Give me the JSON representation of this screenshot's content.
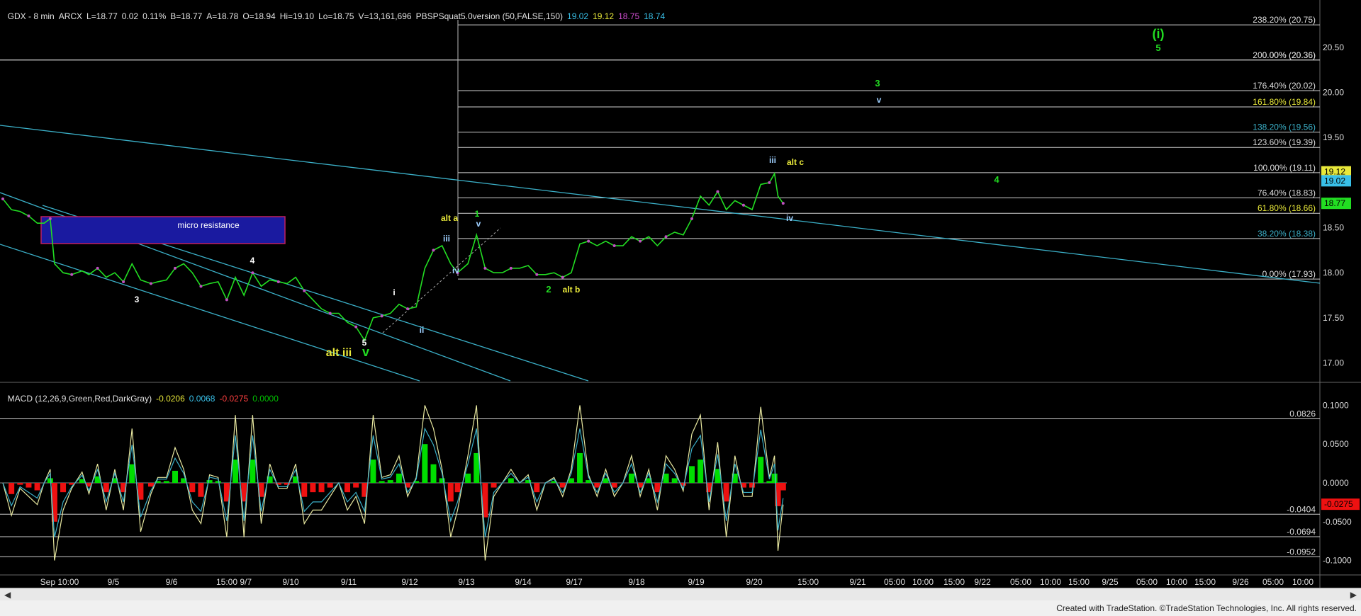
{
  "header": {
    "symbol": "GDX - 8 min",
    "exchange": "ARCX",
    "last": "L=18.77",
    "change": "0.02",
    "change_pct": "0.11%",
    "bid": "B=18.77",
    "ask": "A=18.78",
    "open": "O=18.94",
    "high": "Hi=19.10",
    "low": "Lo=18.75",
    "volume": "V=13,161,696",
    "indicator": "PBSPSquat5.0version (50,FALSE,150)",
    "ind_vals": [
      "19.02",
      "19.12",
      "18.75",
      "18.74"
    ],
    "ind_colors": [
      "#39c0e8",
      "#e8e83a",
      "#d24fd2",
      "#39c0e8"
    ]
  },
  "macd_header": {
    "label": "MACD (12,26,9,Green,Red,DarkGray)",
    "vals": [
      "-0.0206",
      "0.0068",
      "-0.0275",
      "0.0000"
    ],
    "colors": [
      "#e8e83a",
      "#39c0e8",
      "#ff4040",
      "#00c000"
    ]
  },
  "colors": {
    "price": "#22dd22",
    "fib_line": "#d0d0d0",
    "trend_line": "#3bb0c8",
    "micro_box": "#1a1aa0",
    "micro_border": "#c02060",
    "macd_pos": "#00dd00",
    "macd_neg": "#ee1111",
    "macd_line": "#e8e8a0",
    "signal_line": "#3bb0c8"
  },
  "chart_data": {
    "type": "line",
    "title": "GDX - 8 min",
    "ylim": [
      16.8,
      20.9
    ],
    "yticks": [
      "20.50",
      "20.00",
      "19.50",
      "19.00",
      "18.50",
      "18.00",
      "17.50",
      "17.00"
    ],
    "xticks": [
      "Sep 10:00",
      "9/5",
      "9/6",
      "15:00 9/7",
      "9/10",
      "9/11",
      "9/12",
      "9/13",
      "9/14",
      "9/17",
      "9/18",
      "9/19",
      "9/20",
      "15:00",
      "9/21",
      "05:00",
      "10:00",
      "15:00",
      "9/22",
      "05:00",
      "10:00",
      "15:00",
      "9/25",
      "05:00",
      "10:00",
      "15:00",
      "9/26",
      "05:00",
      "10:00"
    ],
    "series": [
      {
        "x": [
          0,
          10,
          20,
          30,
          40,
          48,
          55,
          60,
          70,
          80,
          92,
          100,
          110,
          120,
          130,
          140,
          150,
          160,
          172,
          180,
          190,
          200,
          210,
          220,
          230,
          240,
          250,
          260,
          270,
          280,
          290,
          300,
          310,
          320,
          330,
          340,
          350,
          360,
          370,
          380,
          390,
          400,
          410,
          420,
          430,
          440,
          450,
          460,
          470,
          480,
          490,
          500,
          510,
          520,
          528,
          540,
          550,
          560,
          570,
          580,
          590,
          600,
          610,
          620,
          630,
          640,
          650,
          660,
          670,
          680,
          690,
          700,
          710,
          720,
          730,
          740,
          750,
          760,
          770,
          780,
          790,
          800,
          810,
          820,
          830,
          840,
          850,
          860,
          870,
          880,
          890,
          896,
          900,
          906
        ],
        "values": [
          18.82,
          18.7,
          18.68,
          18.63,
          18.55,
          18.55,
          18.6,
          18.1,
          18.0,
          17.98,
          18.02,
          17.98,
          18.05,
          17.95,
          18.0,
          17.9,
          18.1,
          17.92,
          17.88,
          17.9,
          17.92,
          18.05,
          18.1,
          18.0,
          17.85,
          17.88,
          17.9,
          17.7,
          17.95,
          17.75,
          18.0,
          17.85,
          17.92,
          17.9,
          17.88,
          17.95,
          17.8,
          17.7,
          17.6,
          17.55,
          17.55,
          17.45,
          17.4,
          17.25,
          17.5,
          17.52,
          17.55,
          17.65,
          17.6,
          17.62,
          18.05,
          18.25,
          18.3,
          18.1,
          18.0,
          18.1,
          18.42,
          18.05,
          18.0,
          18.0,
          18.05,
          18.05,
          18.08,
          17.98,
          17.98,
          18.0,
          17.95,
          18.0,
          18.32,
          18.35,
          18.3,
          18.35,
          18.3,
          18.3,
          18.4,
          18.35,
          18.4,
          18.3,
          18.4,
          18.45,
          18.42,
          18.6,
          18.85,
          18.75,
          18.9,
          18.7,
          18.8,
          18.75,
          18.7,
          18.98,
          19.0,
          19.1,
          18.85,
          18.77
        ]
      }
    ],
    "fibs": [
      {
        "label": "238.20% (20.75)",
        "value": 20.75
      },
      {
        "label": "200.00% (20.36)",
        "value": 20.36
      },
      {
        "label": "0.00% (20.36)",
        "value": 20.36
      },
      {
        "label": "176.40% (20.02)",
        "value": 20.02
      },
      {
        "label": "161.80% (19.84)",
        "value": 19.84
      },
      {
        "label": "138.20% (19.56)",
        "value": 19.56
      },
      {
        "label": "123.60% (19.39)",
        "value": 19.39
      },
      {
        "label": "100.00% (19.11)",
        "value": 19.11
      },
      {
        "label": "76.40% (18.83)",
        "value": 18.83
      },
      {
        "label": "61.80% (18.66)",
        "value": 18.66
      },
      {
        "label": "38.20% (18.38)",
        "value": 18.38
      },
      {
        "label": "0.00% (17.93)",
        "value": 17.93
      }
    ],
    "price_tags": [
      {
        "label": "19.12",
        "value": 19.12,
        "color": "#e8e83a"
      },
      {
        "label": "19.02",
        "value": 19.02,
        "color": "#39c0e8"
      },
      {
        "label": "18.77",
        "value": 18.77,
        "color": "#22dd22"
      }
    ],
    "box_label": "micro resistance",
    "wave_labels": [
      {
        "text": "(i)",
        "color": "#22dd22"
      },
      {
        "text": "5",
        "color": "#22dd22"
      },
      {
        "text": "3",
        "color": "#22dd22"
      },
      {
        "text": "v",
        "color": "#9ecfff"
      },
      {
        "text": "4",
        "color": "#22dd22"
      },
      {
        "text": "iii",
        "color": "#9ecfff"
      },
      {
        "text": "alt c",
        "color": "#e8e83a"
      },
      {
        "text": "iv",
        "color": "#9ecfff"
      },
      {
        "text": "alt a",
        "color": "#e8e83a"
      },
      {
        "text": "1",
        "color": "#22dd22"
      },
      {
        "text": "v",
        "color": "#9ecfff"
      },
      {
        "text": "iii",
        "color": "#9ecfff"
      },
      {
        "text": "iv",
        "color": "#9ecfff"
      },
      {
        "text": "2",
        "color": "#22dd22"
      },
      {
        "text": "alt b",
        "color": "#e8e83a"
      },
      {
        "text": "4",
        "color": "#ffffff"
      },
      {
        "text": "3",
        "color": "#ffffff"
      },
      {
        "text": "i",
        "color": "#ffffff"
      },
      {
        "text": "ii",
        "color": "#9ecfff"
      },
      {
        "text": "5",
        "color": "#ffffff"
      },
      {
        "text": "alt iii",
        "color": "#e8e83a"
      },
      {
        "text": "v",
        "color": "#22dd22"
      }
    ],
    "macd": {
      "ylim": [
        -0.115,
        0.115
      ],
      "yticks": [
        "0.1000",
        "0.0500",
        "0.0000",
        "-0.0500",
        "-0.1000"
      ],
      "levels": [
        {
          "label": "0.0826",
          "value": 0.0826
        },
        {
          "label": "-0.0404",
          "value": -0.0404
        },
        {
          "label": "-0.0694",
          "value": -0.0694
        },
        {
          "label": "-0.0952",
          "value": -0.0952
        }
      ],
      "last_tag": {
        "label": "-0.0275",
        "value": -0.0275
      }
    }
  },
  "footer": "Created with TradeStation. ©TradeStation Technologies, Inc. All rights reserved."
}
